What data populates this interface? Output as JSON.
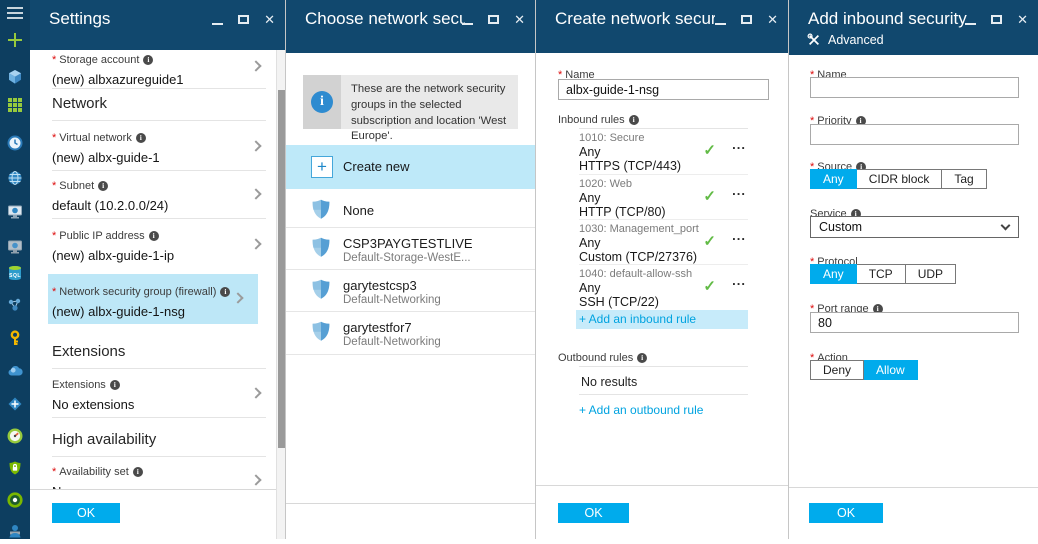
{
  "glyphs": {
    "check": "✓",
    "ellipsis": "...",
    "close": "✕",
    "info": "i",
    "asterisk": "*",
    "plus": "+"
  },
  "colors": {
    "accent": "#00abec",
    "header_blue": "#11486e",
    "sidebar_blue": "#0d3e60",
    "selection": "#bde7f7",
    "check_green": "#62bb46",
    "required_red": "#dd0b0b",
    "link": "#00a3e0"
  },
  "sidebar": {
    "sql_label": "SQL",
    "icons": [
      "menu-icon",
      "add-icon",
      "cube-icon",
      "grid-icon",
      "clock-icon",
      "globe-icon",
      "vm-monitor-icon",
      "monitor-globe-icon",
      "sql-database-icon",
      "molecule-icon",
      "key-icon",
      "cloud-icon",
      "traffic-manager-icon",
      "gauge-icon",
      "shield-lock-icon",
      "cost-icon",
      "user-icon"
    ]
  },
  "blades": {
    "settings": {
      "title": "Settings",
      "sections": {
        "network": "Network",
        "extensions": "Extensions",
        "high_availability": "High availability"
      },
      "rows": {
        "storage": {
          "label": "Storage account",
          "value": "(new) albxazureguide1"
        },
        "virtual_network": {
          "label": "Virtual network",
          "value": "(new) albx-guide-1"
        },
        "subnet": {
          "label": "Subnet",
          "value": "default (10.2.0.0/24)"
        },
        "public_ip": {
          "label": "Public IP address",
          "value": "(new) albx-guide-1-ip"
        },
        "nsg": {
          "label": "Network security group (firewall)",
          "value": "(new) albx-guide-1-nsg"
        },
        "extensions": {
          "label": "Extensions",
          "value": "No extensions"
        },
        "availability": {
          "label": "Availability set",
          "value": "None"
        }
      },
      "ok": "OK"
    },
    "choose": {
      "title": "Choose network securi...",
      "info": "These are the network security groups in the selected subscription and location 'West Europe'.",
      "create_new": "Create new",
      "items": [
        {
          "name": "None",
          "sub": ""
        },
        {
          "name": "CSP3PAYGTESTLIVE",
          "sub": "Default-Storage-WestE..."
        },
        {
          "name": "garytestcsp3",
          "sub": "Default-Networking"
        },
        {
          "name": "garytestfor7",
          "sub": "Default-Networking"
        }
      ]
    },
    "create": {
      "title": "Create network securit...",
      "name_label": "Name",
      "name_value": "albx-guide-1-nsg",
      "inbound_label": "Inbound rules",
      "rules": [
        {
          "id": "1010: Secure",
          "source": "Any",
          "service": "HTTPS (TCP/443)"
        },
        {
          "id": "1020: Web",
          "source": "Any",
          "service": "HTTP (TCP/80)"
        },
        {
          "id": "1030: Management_port",
          "source": "Any",
          "service": "Custom (TCP/27376)"
        },
        {
          "id": "1040: default-allow-ssh",
          "source": "Any",
          "service": "SSH (TCP/22)"
        }
      ],
      "add_inbound": "+ Add an inbound rule",
      "outbound_label": "Outbound rules",
      "no_results": "No results",
      "add_outbound": "+ Add an outbound rule",
      "ok": "OK"
    },
    "add_rule": {
      "title": "Add inbound security r...",
      "advanced": "Advanced",
      "name_label": "Name",
      "name_value": "",
      "priority_label": "Priority",
      "priority_value": "",
      "source_label": "Source",
      "source_options": [
        "Any",
        "CIDR block",
        "Tag"
      ],
      "source_selected": "Any",
      "service_label": "Service",
      "service_value": "Custom",
      "protocol_label": "Protocol",
      "protocol_options": [
        "Any",
        "TCP",
        "UDP"
      ],
      "protocol_selected": "Any",
      "port_label": "Port range",
      "port_value": "80",
      "action_label": "Action",
      "action_options": [
        "Deny",
        "Allow"
      ],
      "action_selected": "Allow",
      "ok": "OK"
    }
  }
}
